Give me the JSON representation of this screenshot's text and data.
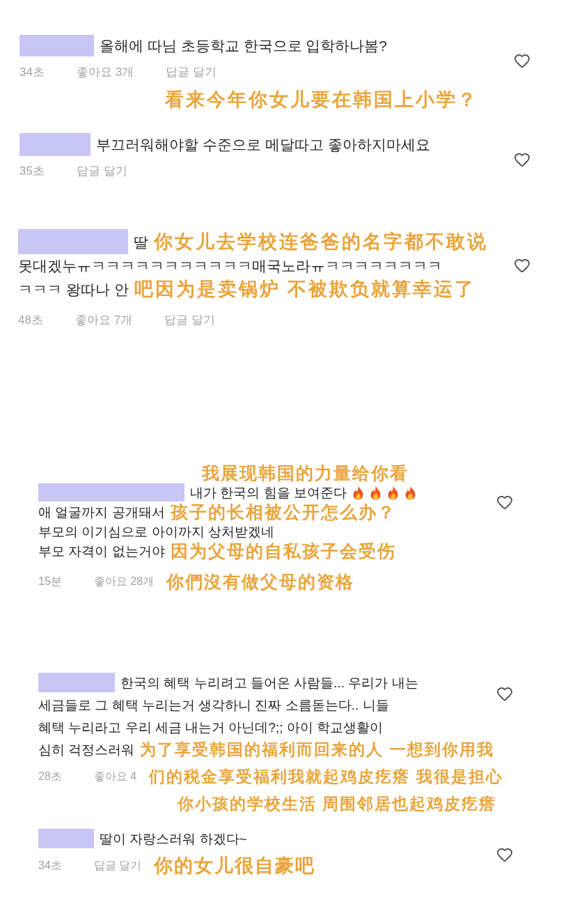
{
  "comments": [
    {
      "liked": false,
      "rows": [
        {
          "items": [
            {
              "kind": "text",
              "text": "올해에 따님 초등학교 한국으로 입학하나봄?"
            }
          ]
        },
        {
          "items": [
            {
              "kind": "time",
              "text": "34초"
            },
            {
              "kind": "likes",
              "text": "좋아요 3개"
            },
            {
              "kind": "reply",
              "text": "답글 달기"
            }
          ]
        },
        {
          "items": [
            {
              "kind": "caption",
              "text": "看来今年你女儿要在韩国上小学？"
            }
          ]
        }
      ]
    },
    {
      "liked": false,
      "rows": [
        {
          "items": [
            {
              "kind": "text",
              "text": "부끄러워해야할 수준으로 메달따고 좋아하지마세요"
            }
          ]
        },
        {
          "items": [
            {
              "kind": "time",
              "text": "35초"
            },
            {
              "kind": "reply",
              "text": "답글 달기"
            }
          ]
        }
      ]
    },
    {
      "liked": false,
      "rows": [
        {
          "items": [
            {
              "kind": "text",
              "text": "딸"
            },
            {
              "kind": "caption",
              "text": "你女儿去学校连爸爸的名字都不敢说"
            }
          ]
        },
        {
          "items": [
            {
              "kind": "text",
              "text": "못대겠누ㅠㅋㅋㅋㅋㅋㅋㅋㅋㅋㅋㅋ매국노라ㅠㅋㅋㅋㅋㅋㅋㅋㅋ"
            }
          ]
        },
        {
          "items": [
            {
              "kind": "text",
              "text": "ㅋㅋㅋ 왕따나 안"
            },
            {
              "kind": "caption",
              "text": "吧因为是卖锅炉 不被欺负就算幸运了"
            }
          ]
        },
        {
          "items": [
            {
              "kind": "time",
              "text": "48초"
            },
            {
              "kind": "likes",
              "text": "좋아요 7개"
            },
            {
              "kind": "reply",
              "text": "답글 달기"
            }
          ]
        }
      ]
    },
    {
      "liked": false,
      "rows": [
        {
          "items": [
            {
              "kind": "caption",
              "text": "我展现韩国的力量给你看"
            }
          ]
        },
        {
          "items": [
            {
              "kind": "text",
              "text": "내가 한국의 힘을 보여준다"
            },
            {
              "kind": "flame"
            },
            {
              "kind": "flame"
            },
            {
              "kind": "flame"
            },
            {
              "kind": "flame"
            }
          ]
        },
        {
          "items": [
            {
              "kind": "text",
              "text": "애 얼굴까지 공개돼서"
            },
            {
              "kind": "caption",
              "text": "孩子的长相被公开怎么办？"
            }
          ]
        },
        {
          "items": [
            {
              "kind": "text",
              "text": "부모의 이기심으로 아이까지 상처받겠네"
            }
          ]
        },
        {
          "items": [
            {
              "kind": "text",
              "text": "부모 자격이 없는거야"
            },
            {
              "kind": "caption",
              "text": "因为父母的自私孩子会受伤"
            }
          ]
        },
        {
          "items": [
            {
              "kind": "time",
              "text": "15분"
            },
            {
              "kind": "likes",
              "text": "좋아요 28개"
            },
            {
              "kind": "caption",
              "text": "你們沒有做父母的资格"
            }
          ]
        }
      ]
    },
    {
      "liked": false,
      "rows": [
        {
          "items": [
            {
              "kind": "text",
              "text": "한국의 혜택 누리려고 들어온 사람들... 우리가 내는"
            }
          ]
        },
        {
          "items": [
            {
              "kind": "text",
              "text": "세금들로 그 혜택 누리는거 생각하니 진짜 소름돋는다.. 니들"
            }
          ]
        },
        {
          "items": [
            {
              "kind": "text",
              "text": "혜택 누리라고 우리 세금 내는거 아닌데?;; 아이 학교생활이"
            }
          ]
        },
        {
          "items": [
            {
              "kind": "text",
              "text": "심히 걱정스러워"
            },
            {
              "kind": "caption",
              "text": "为了享受韩国的福利而回来的人 一想到你用我"
            }
          ]
        },
        {
          "items": [
            {
              "kind": "time",
              "text": "28초"
            },
            {
              "kind": "likes",
              "text": "좋아요 4"
            },
            {
              "kind": "caption",
              "text": "们的税金享受福利我就起鸡皮疙瘩 我很是担心"
            }
          ]
        },
        {
          "items": [
            {
              "kind": "caption",
              "text": "你小孩的学校生活 周围邻居也起鸡皮疙瘩"
            }
          ]
        }
      ]
    },
    {
      "liked": false,
      "rows": [
        {
          "items": [
            {
              "kind": "text",
              "text": "딸이 자랑스러워 하겠다~"
            }
          ]
        },
        {
          "items": [
            {
              "kind": "time",
              "text": "34초"
            },
            {
              "kind": "reply",
              "text": "답글 달기"
            },
            {
              "kind": "caption",
              "text": "你的女儿很自豪吧"
            }
          ]
        }
      ]
    }
  ]
}
